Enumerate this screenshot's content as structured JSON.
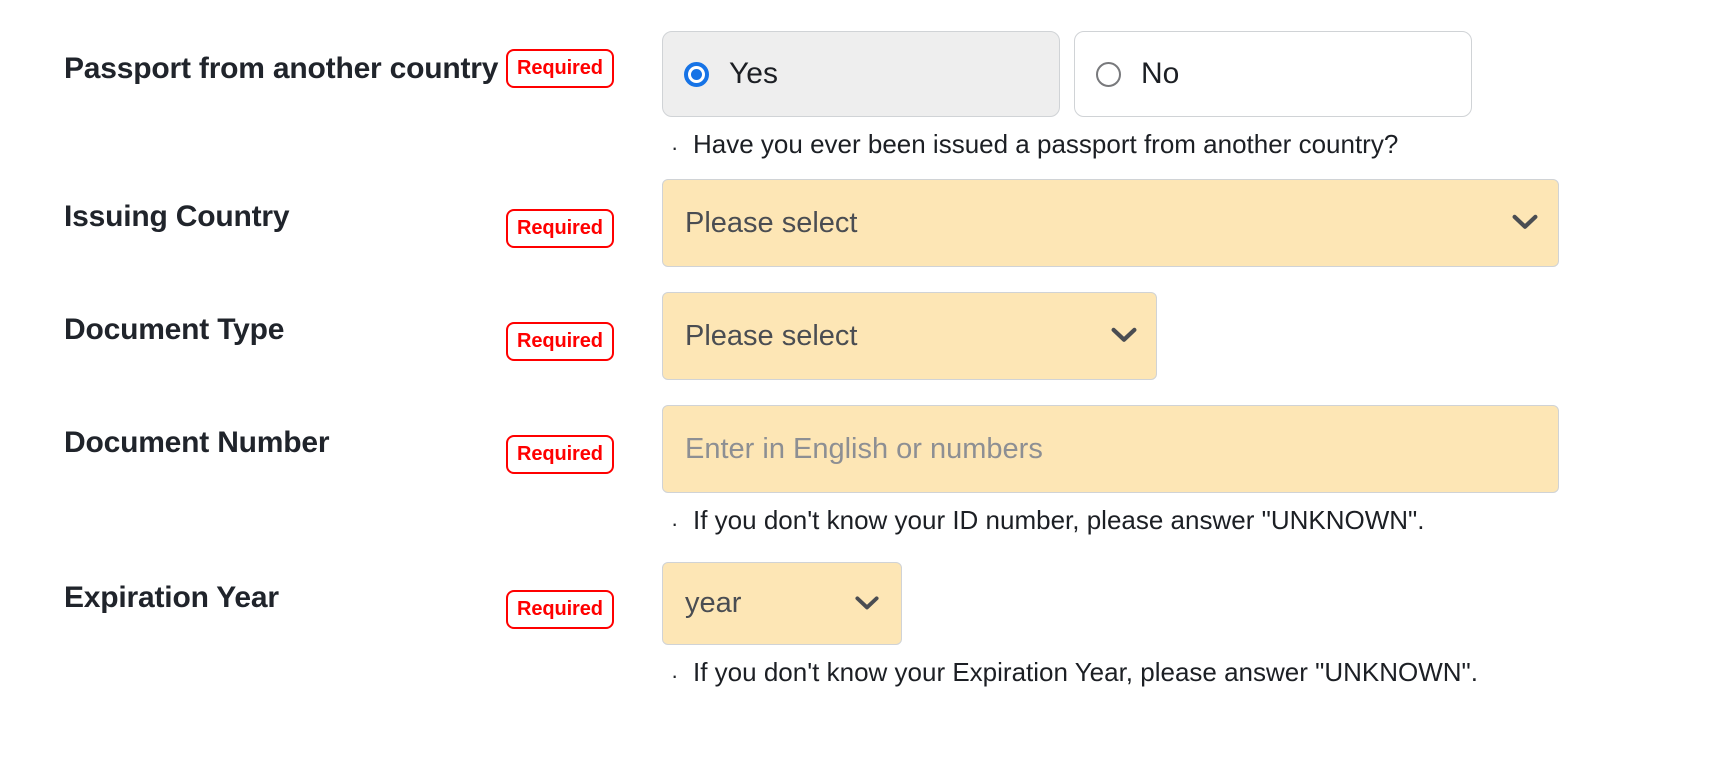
{
  "theme": {
    "required_color": "#ff0000",
    "field_fill": "#fde6b5",
    "field_border": "#d0d3d6",
    "radio_selected_bg": "#eeeeee",
    "radio_accent": "#1673e6",
    "label_color": "#20242b",
    "placeholder_color": "#8d8f93",
    "page_bg": "#ffffff"
  },
  "required_label": "Required",
  "rows": {
    "passport": {
      "label": "Passport from another country",
      "badge": "Required",
      "options": [
        {
          "label": "Yes",
          "selected": true
        },
        {
          "label": "No",
          "selected": false
        }
      ],
      "hint": "Have you ever been issued a passport from another country?"
    },
    "issuing_country": {
      "label": "Issuing Country",
      "badge": "Required",
      "value": "Please select"
    },
    "document_type": {
      "label": "Document Type",
      "badge": "Required",
      "value": "Please select"
    },
    "document_number": {
      "label": "Document Number",
      "badge": "Required",
      "value": "",
      "placeholder": "Enter in English or numbers",
      "hint": "If you don't know your ID number, please answer \"UNKNOWN\"."
    },
    "expiration_year": {
      "label": "Expiration Year",
      "badge": "Required",
      "value": "year",
      "hint": "If you don't know your Expiration Year, please answer \"UNKNOWN\"."
    }
  },
  "icons": {
    "chevron_down": "chevron-down-icon",
    "radio_selected": "radio-selected-icon",
    "radio_empty": "radio-empty-icon",
    "bullet": "·"
  }
}
